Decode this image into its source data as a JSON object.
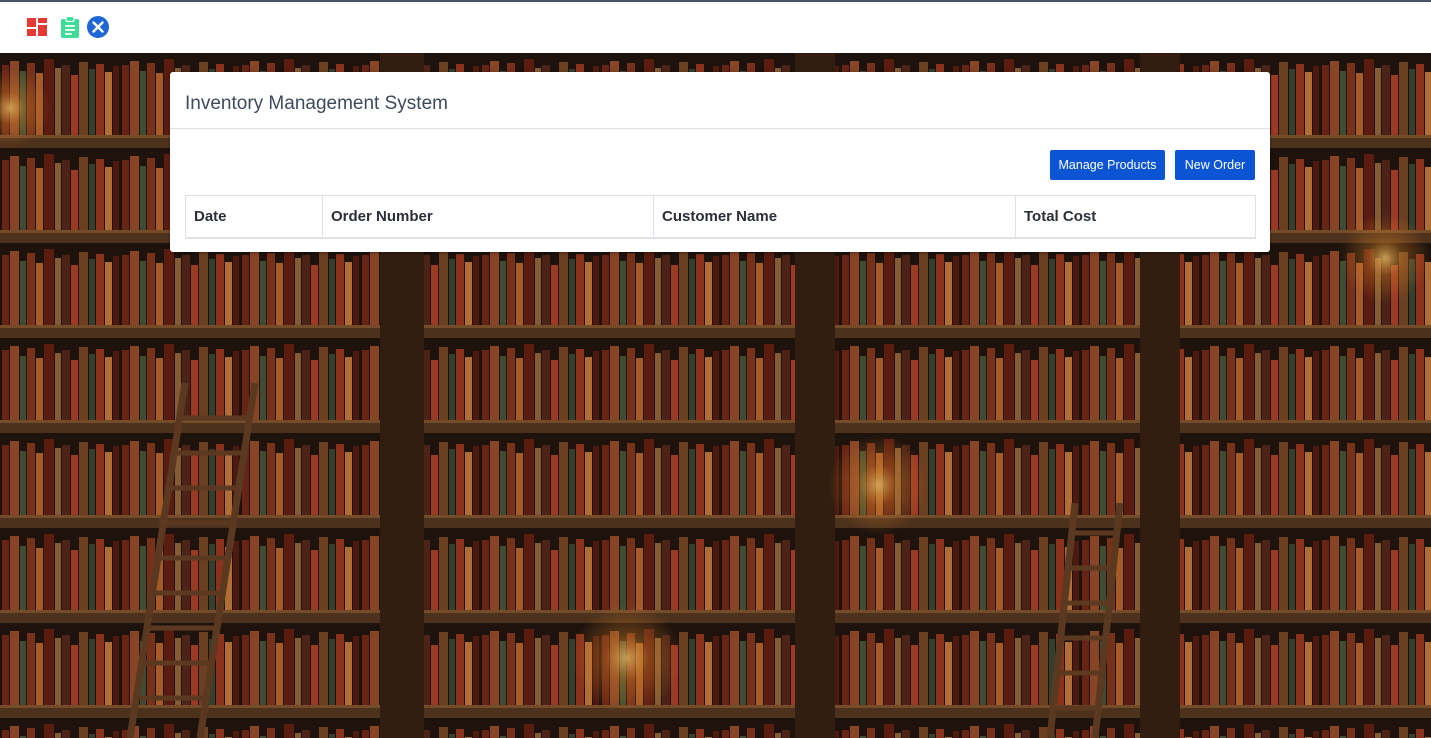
{
  "toolbar": {
    "icons": [
      "dashboard-icon",
      "clipboard-icon",
      "close-circle-icon"
    ],
    "colors": {
      "dashboard": "#e53935",
      "clipboard": "#3ddc97",
      "close": "#1e66d6"
    }
  },
  "card": {
    "title": "Inventory Management System",
    "manage_products_label": "Manage Products",
    "new_order_label": "New Order"
  },
  "orders_table": {
    "columns": [
      "Date",
      "Order Number",
      "Customer Name",
      "Total Cost"
    ],
    "rows": []
  },
  "colors": {
    "accent": "#0b55d4",
    "card_title": "#3f4a5c"
  }
}
